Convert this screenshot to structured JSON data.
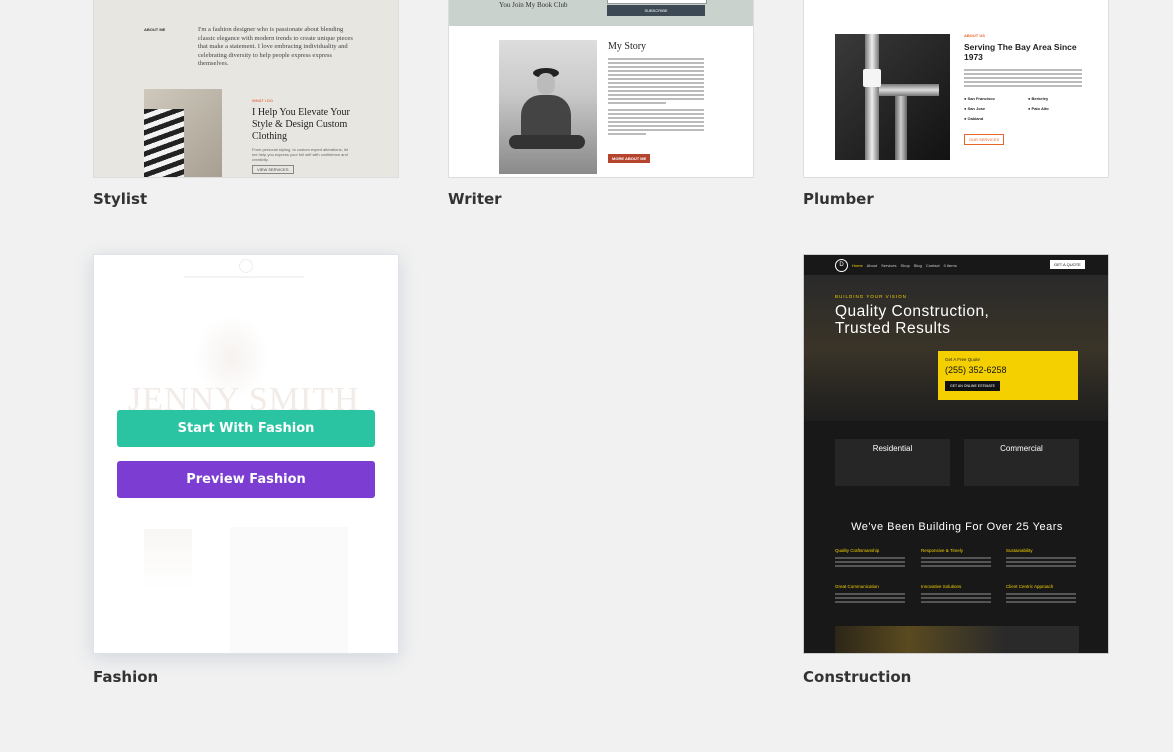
{
  "layouts": [
    {
      "id": "stylist",
      "name": "Stylist"
    },
    {
      "id": "writer",
      "name": "Writer"
    },
    {
      "id": "plumber",
      "name": "Plumber"
    },
    {
      "id": "fashion",
      "name": "Fashion"
    },
    {
      "id": "construction",
      "name": "Construction"
    }
  ],
  "stylist": {
    "about_label": "ABOUT ME",
    "about_text": "I'm a fashion designer who is passionate about blending classic elegance with modern trends to create unique pieces that make a statement. I love embracing individuality and celebrating diversity to help people express express themselves.",
    "what_label": "WHAT I DO",
    "heading": "I Help You Elevate Your Style & Design Custom Clothing",
    "body": "From personal styling, to custom expert alterations, let me help you express your full self with confidence and creativity.",
    "cta": "VIEW SERVICES"
  },
  "writer": {
    "book_club": "You Join My Book Club",
    "subscribe": "SUBSCRIBE",
    "story_title": "My Story",
    "cta": "MORE ABOUT ME"
  },
  "plumber": {
    "about_label": "ABOUT US",
    "heading": "Serving The Bay Area Since 1973",
    "cities": [
      "San Francisco",
      "Berkeley",
      "San Jose",
      "Palo Alto",
      "Oakland"
    ],
    "cta": "OUR SERVICES"
  },
  "fashion": {
    "hero_name": "JENNY SMITH",
    "start_label": "Start With Fashion",
    "preview_label": "Preview Fashion"
  },
  "construction": {
    "nav": [
      "Home",
      "About",
      "Services",
      "Shop",
      "Blog",
      "Contact",
      "0 Items"
    ],
    "nav_cta": "GET A QUOTE",
    "eyebrow": "BUILDING YOUR VISION",
    "headline": "Quality Construction, Trusted Results",
    "quote_label": "Get A Free Quote",
    "phone": "(255) 352-6258",
    "quote_button": "GET AN ONLINE ESTIMATE",
    "service1": "Residential",
    "service2": "Commercial",
    "section_title": "We've Been Building For Over 25 Years",
    "features": [
      "Quality Craftsmanship",
      "Responsive & Timely",
      "Sustainability",
      "Great Communication",
      "Innovative Solutions",
      "Client Centric Approach"
    ]
  },
  "colors": {
    "start": "#2bc4a3",
    "preview": "#7b3dd2",
    "construction_yellow": "#f5d000",
    "plumber_orange": "#e8652a",
    "writer_red": "#b5452e"
  }
}
